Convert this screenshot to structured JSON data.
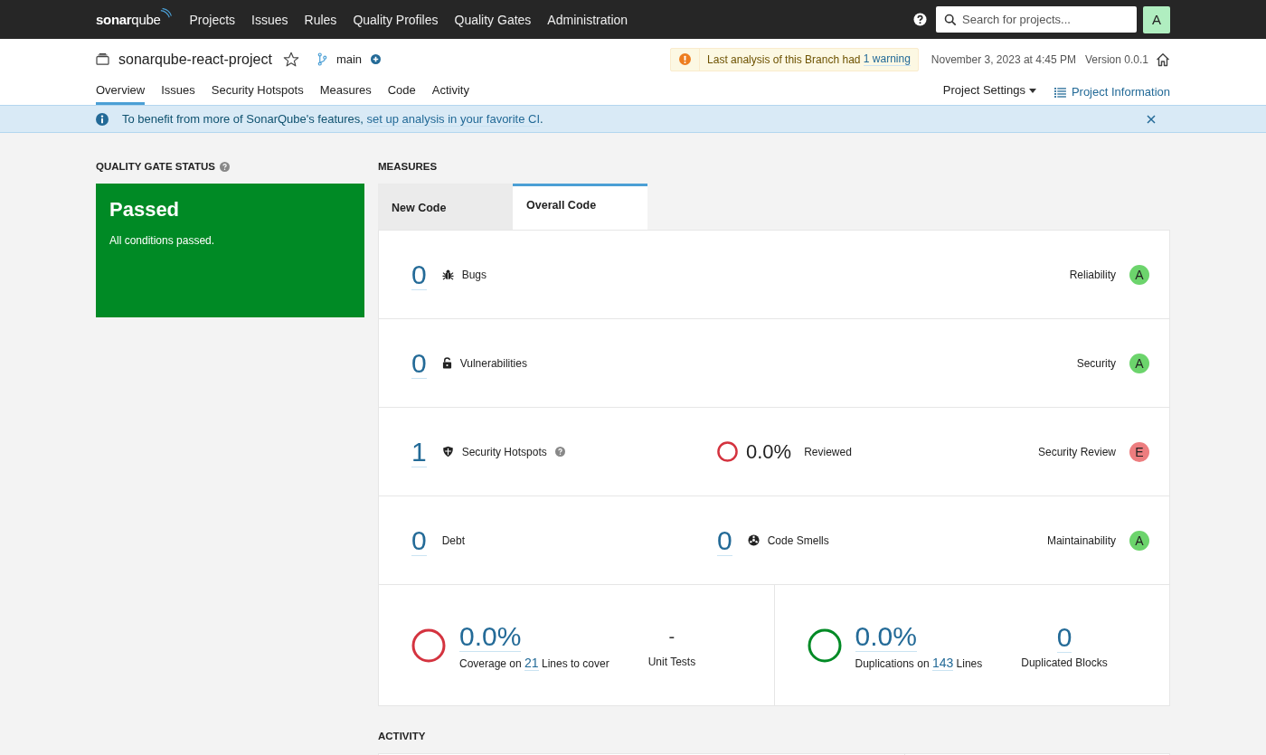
{
  "top_nav": {
    "logo": "**sonar**qube",
    "items": [
      {
        "label": "Projects",
        "selected": false
      },
      {
        "label": "Issues",
        "selected": false
      },
      {
        "label": "Rules",
        "selected": false
      },
      {
        "label": "Quality Profiles",
        "selected": false
      },
      {
        "label": "Quality Gates",
        "selected": false
      },
      {
        "label": "Administration",
        "selected": false
      }
    ],
    "search": {
      "placeholder": "Search for projects..."
    },
    "avatar": "A"
  },
  "project": {
    "name": "sonarqube-react-project",
    "starred": false,
    "branch": "main",
    "warning": {
      "text": "Last analysis of this Branch had ",
      "link": "1 warning"
    },
    "date": "November 3, 2023 at 4:45 PM",
    "version": "Version 0.0.1"
  },
  "tabs": [
    {
      "label": "Overview",
      "selected": true
    },
    {
      "label": "Issues",
      "selected": false
    },
    {
      "label": "Security Hotspots",
      "selected": false
    },
    {
      "label": "Measures",
      "selected": false
    },
    {
      "label": "Code",
      "selected": false
    },
    {
      "label": "Activity",
      "selected": false
    }
  ],
  "project_settings": "Project Settings",
  "project_information": "Project Information",
  "banner": {
    "before": "To benefit from more of SonarQube's features, ",
    "link": "set up analysis in your favorite CI",
    "after": "."
  },
  "quality_gate": {
    "title": "QUALITY GATE STATUS",
    "label": "Passed",
    "message": "All conditions passed."
  },
  "measures": {
    "title": "MEASURES",
    "tabs": [
      {
        "label": "New Code",
        "selected": false
      },
      {
        "label": "Overall Code",
        "selected": true
      }
    ],
    "rows": [
      {
        "kind": "bugs",
        "value": "0",
        "label": "Bugs",
        "help": false,
        "rating_label": "Reliability",
        "rating": "A",
        "color": "#6cd46c"
      },
      {
        "kind": "vulnerabilities",
        "value": "0",
        "label": "Vulnerabilities",
        "help": false,
        "rating_label": "Security",
        "rating": "A",
        "color": "#6cd46c"
      },
      {
        "kind": "hotspots",
        "value": "1",
        "label": "Security Hotspots",
        "help": true,
        "middle": {
          "kind": "review",
          "value": "0.0%",
          "label": "Reviewed",
          "color": "#d4333f"
        },
        "rating_label": "Security Review",
        "rating": "E",
        "color": "#ed7d7f"
      },
      {
        "kind": "debt",
        "value": "0",
        "label": "Debt",
        "help": false,
        "middle": {
          "kind": "smells",
          "value": "0",
          "label": "Code Smells"
        },
        "rating_label": "Maintainability",
        "rating": "A",
        "color": "#6cd46c"
      }
    ],
    "coverage": {
      "color": "#d4333f",
      "value": "0.0%",
      "prefix": "Coverage on ",
      "lines": "21",
      "suffix": " Lines to cover",
      "tests": "-",
      "tests_label": "Unit Tests"
    },
    "duplications": {
      "color": "#008a25",
      "value": "0.0%",
      "prefix": "Duplications on ",
      "lines": "143",
      "suffix": " Lines",
      "blocks": "0",
      "blocks_label": "Duplicated Blocks"
    }
  },
  "activity": {
    "title": "ACTIVITY"
  }
}
